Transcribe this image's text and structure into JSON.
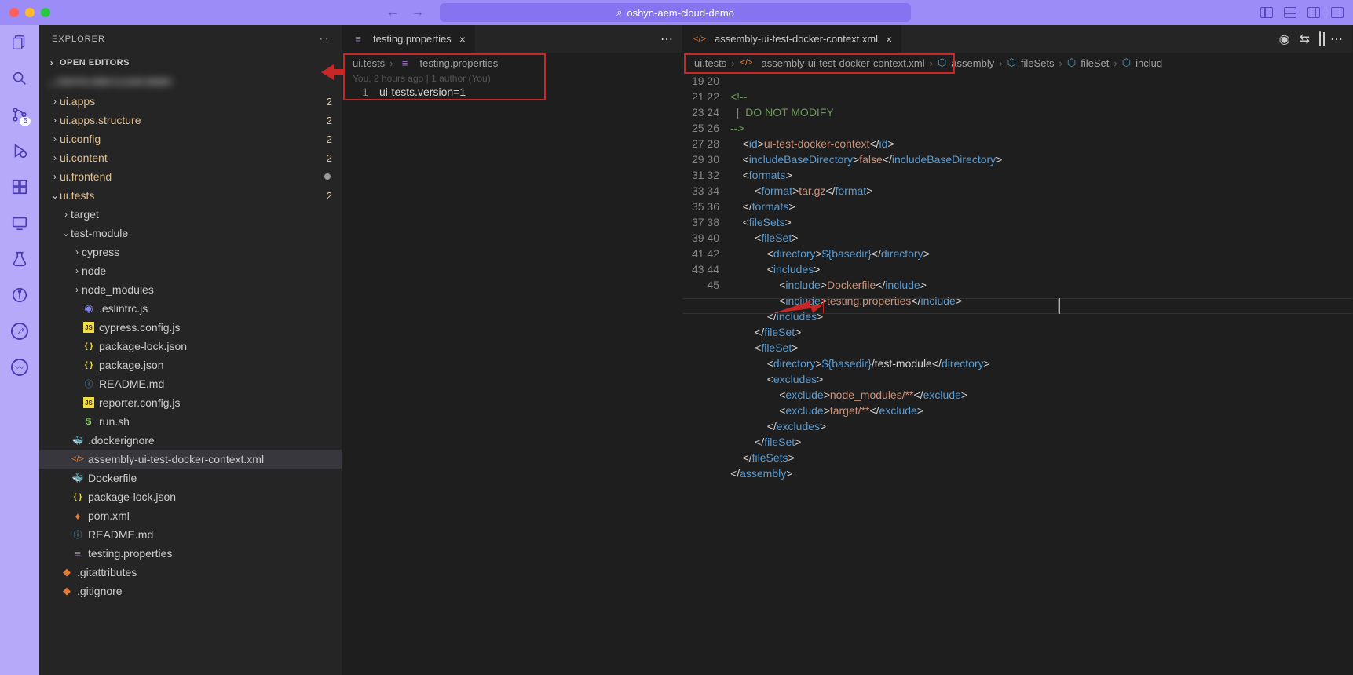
{
  "title": "oshyn-aem-cloud-demo",
  "sidebar": {
    "header": "EXPLORER",
    "open_editors": "OPEN EDITORS",
    "tree": [
      {
        "name": "ui.apps",
        "indent": 14,
        "chev": "›",
        "folder": true,
        "yellow": true,
        "badge": "2"
      },
      {
        "name": "ui.apps.structure",
        "indent": 14,
        "chev": "›",
        "folder": true,
        "yellow": true,
        "badge": "2"
      },
      {
        "name": "ui.config",
        "indent": 14,
        "chev": "›",
        "folder": true,
        "yellow": true,
        "badge": "2"
      },
      {
        "name": "ui.content",
        "indent": 14,
        "chev": "›",
        "folder": true,
        "yellow": true,
        "badge": "2"
      },
      {
        "name": "ui.frontend",
        "indent": 14,
        "chev": "›",
        "folder": true,
        "yellow": true,
        "moddot": true
      },
      {
        "name": "ui.tests",
        "indent": 14,
        "chev": "⌄",
        "folder": true,
        "yellow": true,
        "badge": "2"
      },
      {
        "name": "target",
        "indent": 28,
        "chev": "›",
        "folder": true
      },
      {
        "name": "test-module",
        "indent": 28,
        "chev": "⌄",
        "folder": true
      },
      {
        "name": "cypress",
        "indent": 42,
        "chev": "›",
        "folder": true
      },
      {
        "name": "node",
        "indent": 42,
        "chev": "›",
        "folder": true
      },
      {
        "name": "node_modules",
        "indent": 42,
        "chev": "›",
        "folder": true
      },
      {
        "name": ".eslintrc.js",
        "indent": 42,
        "icon": "eslint"
      },
      {
        "name": "cypress.config.js",
        "indent": 42,
        "icon": "js"
      },
      {
        "name": "package-lock.json",
        "indent": 42,
        "icon": "json"
      },
      {
        "name": "package.json",
        "indent": 42,
        "icon": "json"
      },
      {
        "name": "README.md",
        "indent": 42,
        "icon": "md"
      },
      {
        "name": "reporter.config.js",
        "indent": 42,
        "icon": "js"
      },
      {
        "name": "run.sh",
        "indent": 42,
        "icon": "sh"
      },
      {
        "name": ".dockerignore",
        "indent": 28,
        "icon": "docker"
      },
      {
        "name": "assembly-ui-test-docker-context.xml",
        "indent": 28,
        "icon": "xml",
        "selected": true
      },
      {
        "name": "Dockerfile",
        "indent": 28,
        "icon": "docker"
      },
      {
        "name": "package-lock.json",
        "indent": 28,
        "icon": "json"
      },
      {
        "name": "pom.xml",
        "indent": 28,
        "icon": "pom"
      },
      {
        "name": "README.md",
        "indent": 28,
        "icon": "md"
      },
      {
        "name": "testing.properties",
        "indent": 28,
        "icon": "prop"
      },
      {
        "name": ".gitattributes",
        "indent": 14,
        "icon": "git"
      },
      {
        "name": ".gitignore",
        "indent": 14,
        "icon": "git"
      }
    ]
  },
  "editor1": {
    "tab": "testing.properties",
    "breadcrumb": [
      "ui.tests",
      "testing.properties"
    ],
    "blame": "You, 2 hours ago | 1 author (You)",
    "line1": "ui-tests.version=1"
  },
  "editor2": {
    "tab": "assembly-ui-test-docker-context.xml",
    "breadcrumb": [
      "ui.tests",
      "assembly-ui-test-docker-context.xml",
      "assembly",
      "fileSets",
      "fileSet",
      "includ"
    ],
    "lines": [
      {
        "n": 19,
        "txt": ""
      },
      {
        "n": 20,
        "txt": "<!--",
        "type": "cmt"
      },
      {
        "n": 21,
        "txt": "  |  DO NOT MODIFY",
        "type": "cmt"
      },
      {
        "n": 22,
        "txt": "-->",
        "type": "cmt"
      },
      {
        "n": 23,
        "txt": "    <id>ui-test-docker-context</id>"
      },
      {
        "n": 24,
        "txt": "    <includeBaseDirectory>false</includeBaseDirectory>"
      },
      {
        "n": 25,
        "txt": "    <formats>"
      },
      {
        "n": 26,
        "txt": "        <format>tar.gz</format>"
      },
      {
        "n": 27,
        "txt": "    </formats>"
      },
      {
        "n": 28,
        "txt": "    <fileSets>"
      },
      {
        "n": 29,
        "txt": "        <fileSet>"
      },
      {
        "n": 30,
        "txt": "            <directory>${basedir}</directory>"
      },
      {
        "n": 31,
        "txt": "            <includes>"
      },
      {
        "n": 32,
        "txt": "                <include>Dockerfile</include>"
      },
      {
        "n": 33,
        "txt": "                <include>testing.properties</include>"
      },
      {
        "n": 34,
        "txt": "            </includes>"
      },
      {
        "n": 35,
        "txt": "        </fileSet>"
      },
      {
        "n": 36,
        "txt": "        <fileSet>"
      },
      {
        "n": 37,
        "txt": "            <directory>${basedir}/test-module</directory>"
      },
      {
        "n": 38,
        "txt": "            <excludes>"
      },
      {
        "n": 39,
        "txt": "                <exclude>node_modules/**</exclude>"
      },
      {
        "n": 40,
        "txt": "                <exclude>target/**</exclude>"
      },
      {
        "n": 41,
        "txt": "            </excludes>"
      },
      {
        "n": 42,
        "txt": "        </fileSet>"
      },
      {
        "n": 43,
        "txt": "    </fileSets>"
      },
      {
        "n": 44,
        "txt": "</assembly>"
      },
      {
        "n": 45,
        "txt": ""
      }
    ]
  },
  "scm_badge": "5"
}
